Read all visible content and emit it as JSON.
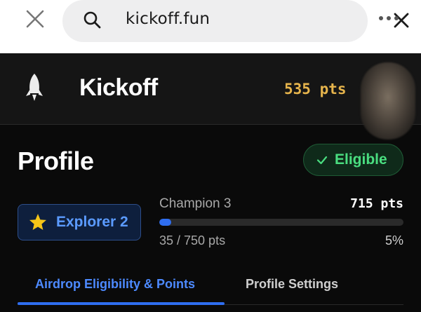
{
  "browser": {
    "url": "kickoff.fun",
    "icons": {
      "close": "close-icon",
      "search": "search-icon",
      "clear": "clear-icon",
      "more": "more-dots-icon"
    }
  },
  "header": {
    "brand": "Kickoff",
    "points": "535 pts",
    "icons": {
      "logo": "rocket-icon"
    }
  },
  "profile": {
    "title": "Profile",
    "eligibility": "Eligible",
    "tier_badge": "Explorer 2",
    "next_tier": "Champion 3",
    "next_tier_points": "715 pts",
    "progress_text": "35 / 750 pts",
    "progress_percent_text": "5%",
    "progress_fraction": 0.05
  },
  "tabs": [
    {
      "label": "Airdrop Eligibility & Points",
      "active": true
    },
    {
      "label": "Profile Settings",
      "active": false
    }
  ],
  "colors": {
    "accent": "#2f6ef0",
    "eligible": "#4ade80",
    "points": "#e6b44c",
    "tier": "#5b9bff"
  }
}
